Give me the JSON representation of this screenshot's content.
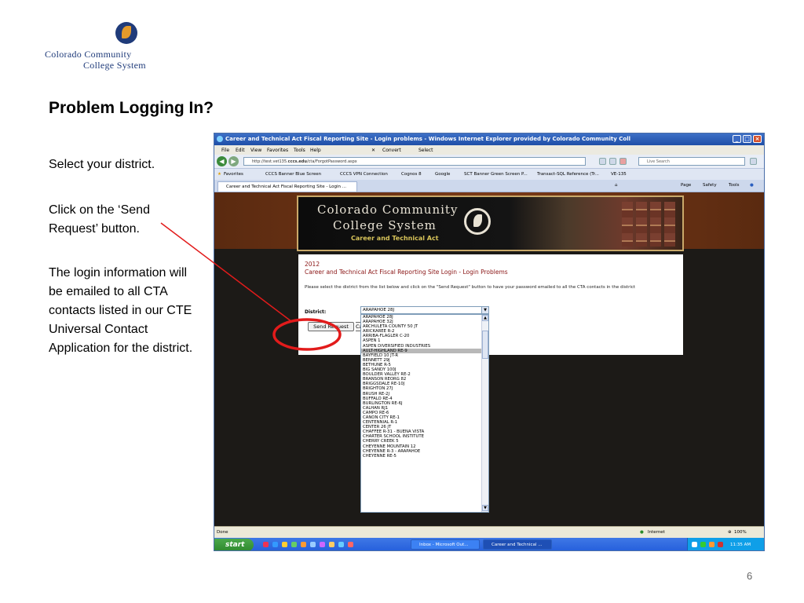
{
  "logo": {
    "line1": "Colorado Community",
    "line2": "College System"
  },
  "slide": {
    "title": "Problem Logging In?",
    "notes": [
      "Select your district.",
      "Click on the ‘Send Request’ button.",
      "The login information will be emailed to all CTA contacts listed in our CTE Universal Contact Application for the district."
    ],
    "page_number": "6"
  },
  "browser": {
    "title": "Career and Technical Act Fiscal Reporting Site - Login problems - Windows Internet Explorer provided by Colorado Community Coll",
    "menu": [
      "File",
      "Edit",
      "View",
      "Favorites",
      "Tools",
      "Help"
    ],
    "convert_label": "Convert",
    "select_label": "Select",
    "address_prefix": "http://test.vet135.",
    "address_bold": "cccs.edu",
    "address_suffix": "/cta/ForgotPassword.aspx",
    "search_placeholder": "Live Search",
    "favorites_label": "Favorites",
    "favorites": [
      "CCCS Banner Blue Screen",
      "CCCS VPN Connection",
      "Cognos 8",
      "Google",
      "SCT Banner Green Screen P...",
      "Transact-SQL Reference (Tr...",
      "VE-135"
    ],
    "tab_label": "Career and Technical Act Fiscal Reporting Site - Login ...",
    "tab_tools": [
      "Page",
      "Safety",
      "Tools"
    ],
    "status_left": "Done",
    "status_zone": "Internet",
    "status_zoom": "100%"
  },
  "site": {
    "banner_line1": "Colorado Community",
    "banner_line2": "College System",
    "banner_line3": "Career and Technical Act",
    "year": "2012",
    "page_title": "Career and Technical Act Fiscal Reporting Site Login - Login Problems",
    "description": "Please select the district from the list below and click on the \"Send Request\" button to have your password emailed to all the CTA contacts in the district",
    "district_label": "District:",
    "district_selected": "ARAPAHOE 28J",
    "send_button": "Send Request",
    "cancel_fragment": "Ca",
    "district_options": [
      "ARAPAHOE 28J",
      "ARAPAHOE 32J",
      "ARCHULETA COUNTY 50 JT",
      "ARICKAREE R-2",
      "ARRIBA-FLAGLER C-20",
      "ASPEN 1",
      "ASPEN DIVERSIFIED INDUSTRIES",
      "AULT-HIGHLAND RE-9",
      "BAYFIELD 10 JT-R",
      "BENNETT 29J",
      "BETHUNE R-5",
      "BIG SANDY 100J",
      "BOULDER VALLEY RE-2",
      "BRANSON REORG 82",
      "BRIGGSDALE RE-10J",
      "BRIGHTON 27J",
      "BRUSH RE-2J",
      "BUFFALO RE-4",
      "BURLINGTON RE-6J",
      "CALHAN RJ1",
      "CAMPO RE-6",
      "CANON CITY RE-1",
      "CENTENNIAL R-1",
      "CENTER 26 JT",
      "CHAFFEE R-31 - BUENA VISTA",
      "CHARTER SCHOOL INSTITUTE",
      "CHERRY CREEK 5",
      "CHEYENNE MOUNTAIN 12",
      "CHEYENNE R-3 - ARAPAHOE",
      "CHEYENNE RE-5"
    ],
    "district_highlighted": "AULT-HIGHLAND RE-9"
  },
  "taskbar": {
    "start_label": "start",
    "tasks": [
      "Inbox - Microsoft Out...",
      "Career and Technical ..."
    ],
    "clock": "11:35 AM"
  },
  "colors": {
    "annotation_red": "#e21b1b",
    "site_heading": "#8a1515",
    "brand_navy": "#1f3b7a"
  }
}
